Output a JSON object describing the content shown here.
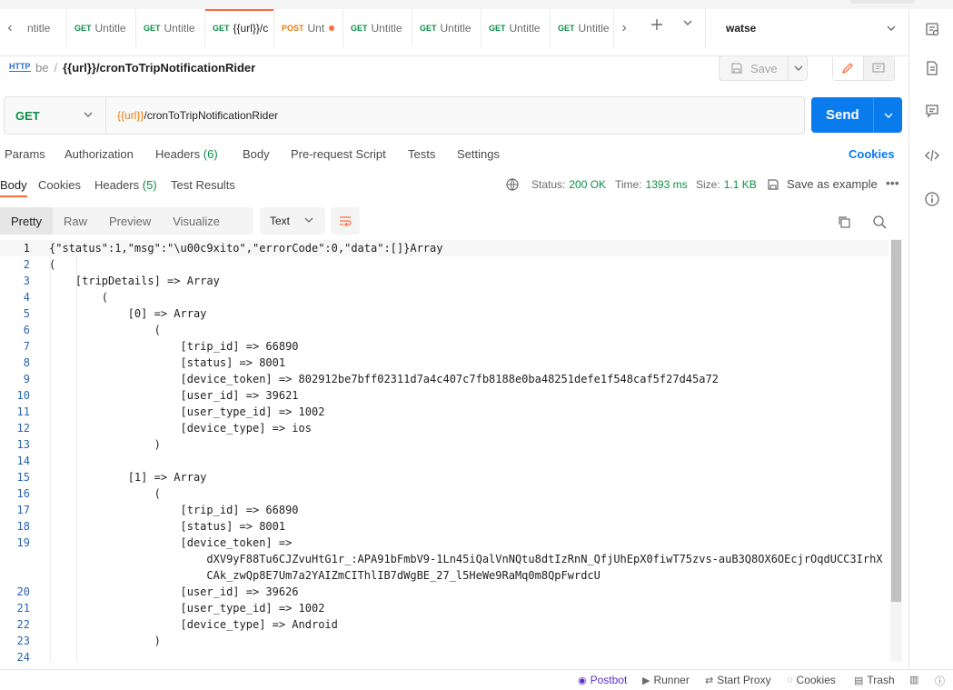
{
  "tabs": [
    {
      "method": "",
      "label": "ntitle"
    },
    {
      "method": "GET",
      "label": "Untitle"
    },
    {
      "method": "GET",
      "label": "Untitle"
    },
    {
      "method": "GET",
      "label": "{{url}}/c",
      "active": true
    },
    {
      "method": "POST",
      "label": "Unt",
      "unsaved": true
    },
    {
      "method": "GET",
      "label": "Untitle"
    },
    {
      "method": "GET",
      "label": "Untitle"
    },
    {
      "method": "GET",
      "label": "Untitle"
    },
    {
      "method": "GET",
      "label": "Untitle"
    }
  ],
  "environment": {
    "name": "watse"
  },
  "breadcrumb": {
    "collection": "be",
    "separator": "/",
    "request_name": "{{url}}/cronToTripNotificationRider"
  },
  "toolbar": {
    "save_label": "Save"
  },
  "request": {
    "method": "GET",
    "url_var": "{{url}}",
    "url_path": "/cronToTripNotificationRider",
    "send_label": "Send"
  },
  "request_tabs": {
    "params": "Params",
    "authorization": "Authorization",
    "headers": "Headers",
    "headers_count": "(6)",
    "body": "Body",
    "prerequest": "Pre-request Script",
    "tests": "Tests",
    "settings": "Settings",
    "cookies": "Cookies"
  },
  "response_tabs": {
    "body": "Body",
    "cookies": "Cookies",
    "headers": "Headers",
    "headers_count": "(5)",
    "test_results": "Test Results"
  },
  "response_meta": {
    "status_label": "Status:",
    "status": "200 OK",
    "time_label": "Time:",
    "time": "1393 ms",
    "size_label": "Size:",
    "size": "1.1 KB",
    "save_example": "Save as example"
  },
  "view": {
    "modes": [
      "Pretty",
      "Raw",
      "Preview",
      "Visualize"
    ],
    "format": "Text"
  },
  "code_lines": [
    {
      "n": "1",
      "text": "{\"status\":1,\"msg\":\"\\u00c9xito\",\"errorCode\":0,\"data\":[]}Array"
    },
    {
      "n": "2",
      "text": "("
    },
    {
      "n": "3",
      "text": "    [tripDetails] => Array"
    },
    {
      "n": "4",
      "text": "        ("
    },
    {
      "n": "5",
      "text": "            [0] => Array"
    },
    {
      "n": "6",
      "text": "                ("
    },
    {
      "n": "7",
      "text": "                    [trip_id] => 66890"
    },
    {
      "n": "8",
      "text": "                    [status] => 8001"
    },
    {
      "n": "9",
      "text": "                    [device_token] => 802912be7bff02311d7a4c407c7fb8188e0ba48251defe1f548caf5f27d45a72"
    },
    {
      "n": "10",
      "text": "                    [user_id] => 39621"
    },
    {
      "n": "11",
      "text": "                    [user_type_id] => 1002"
    },
    {
      "n": "12",
      "text": "                    [device_type] => ios"
    },
    {
      "n": "13",
      "text": "                )"
    },
    {
      "n": "14",
      "text": ""
    },
    {
      "n": "15",
      "text": "            [1] => Array"
    },
    {
      "n": "16",
      "text": "                ("
    },
    {
      "n": "17",
      "text": "                    [trip_id] => 66890"
    },
    {
      "n": "18",
      "text": "                    [status] => 8001"
    },
    {
      "n": "19",
      "text": "                    [device_token] =>"
    },
    {
      "n": "",
      "text": "                        dXV9yF88Tu6CJZvuHtG1r_:APA91bFmbV9-1Ln45iQalVnNQtu8dtIzRnN_QfjUhEpX0fiwT75zvs-auB3Q8OX6OEcjrOqdUCC3IrhX"
    },
    {
      "n": "",
      "text": "                        CAk_zwQp8E7Um7a2YAIZmCIThlIB7dWgBE_27_l5HeWe9RaMq0m8QpFwrdcU"
    },
    {
      "n": "20",
      "text": "                    [user_id] => 39626"
    },
    {
      "n": "21",
      "text": "                    [user_type_id] => 1002"
    },
    {
      "n": "22",
      "text": "                    [device_type] => Android"
    },
    {
      "n": "23",
      "text": "                )"
    },
    {
      "n": "24",
      "text": ""
    }
  ],
  "statusbar": {
    "postbot": "Postbot",
    "runner": "Runner",
    "proxy": "Start Proxy",
    "cookies": "Cookies",
    "trash": "Trash"
  },
  "colors": {
    "accent": "#ff6c37",
    "primary": "#097bed",
    "get": "#0c8d47",
    "post": "#e97d09",
    "url_var": "#e97d09"
  }
}
